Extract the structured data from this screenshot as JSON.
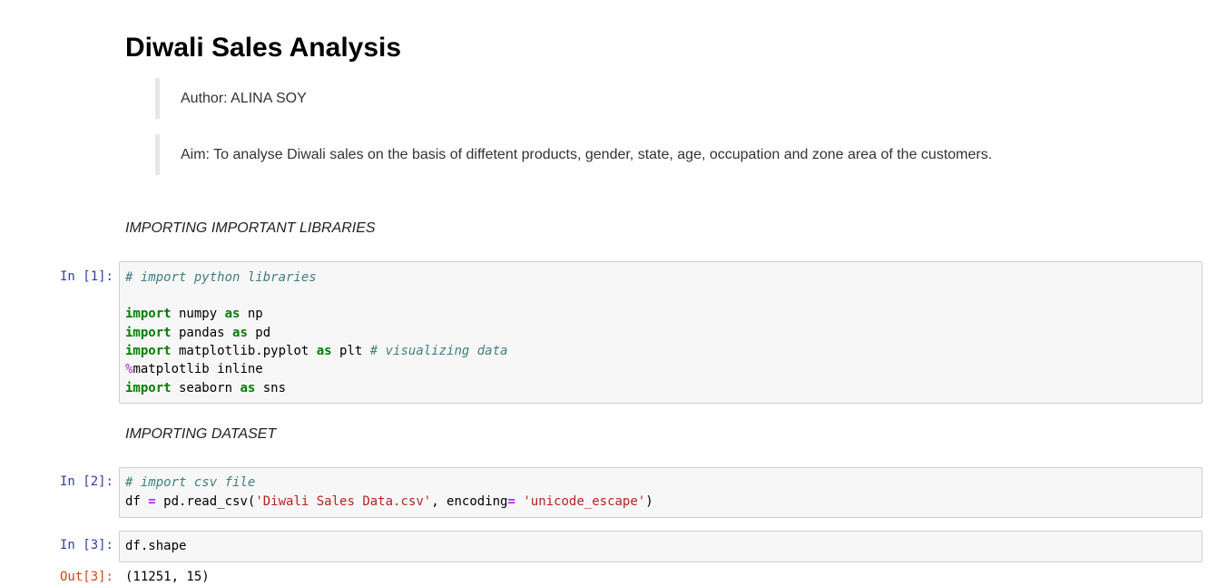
{
  "notebook": {
    "title": "Diwali Sales Analysis",
    "author_note": "Author: ALINA SOY",
    "aim_note": "Aim: To analyse Diwali sales on the basis of diffetent products, gender, state, age, occupation and zone area of the customers.",
    "section_libraries": "IMPORTING IMPORTANT LIBRARIES",
    "section_dataset": "IMPORTING DATASET"
  },
  "cells": {
    "cell1": {
      "prompt": "In [1]:",
      "comment": "# import python libraries",
      "line_numpy": {
        "kw1": "import",
        "mod": " numpy ",
        "kw2": "as",
        "alias": " np"
      },
      "line_pandas": {
        "kw1": "import",
        "mod": " pandas ",
        "kw2": "as",
        "alias": " pd"
      },
      "line_plt": {
        "kw1": "import",
        "mod": " matplotlib.pyplot ",
        "kw2": "as",
        "alias": " plt ",
        "comment": "# visualizing data"
      },
      "line_magic": {
        "pct": "%",
        "rest": "matplotlib inline"
      },
      "line_sns": {
        "kw1": "import",
        "mod": " seaborn ",
        "kw2": "as",
        "alias": " sns"
      }
    },
    "cell2": {
      "prompt": "In [2]:",
      "comment": "# import csv file",
      "code": {
        "var": "df ",
        "eq": "=",
        "call": " pd.read_csv(",
        "str1": "'Diwali Sales Data.csv'",
        "mid": ", encoding",
        "eq2": "=",
        "sp": " ",
        "str2": "'unicode_escape'",
        "end": ")"
      }
    },
    "cell3": {
      "prompt": "In [3]:",
      "code": "df.shape",
      "out_prompt": "Out[3]:",
      "output": "(11251, 15)"
    }
  },
  "colors": {
    "keyword": "#008000",
    "comment": "#408080",
    "string": "#ba2121",
    "magic": "#aa22ff",
    "in_prompt": "#303f9f",
    "out_prompt": "#d84315"
  }
}
